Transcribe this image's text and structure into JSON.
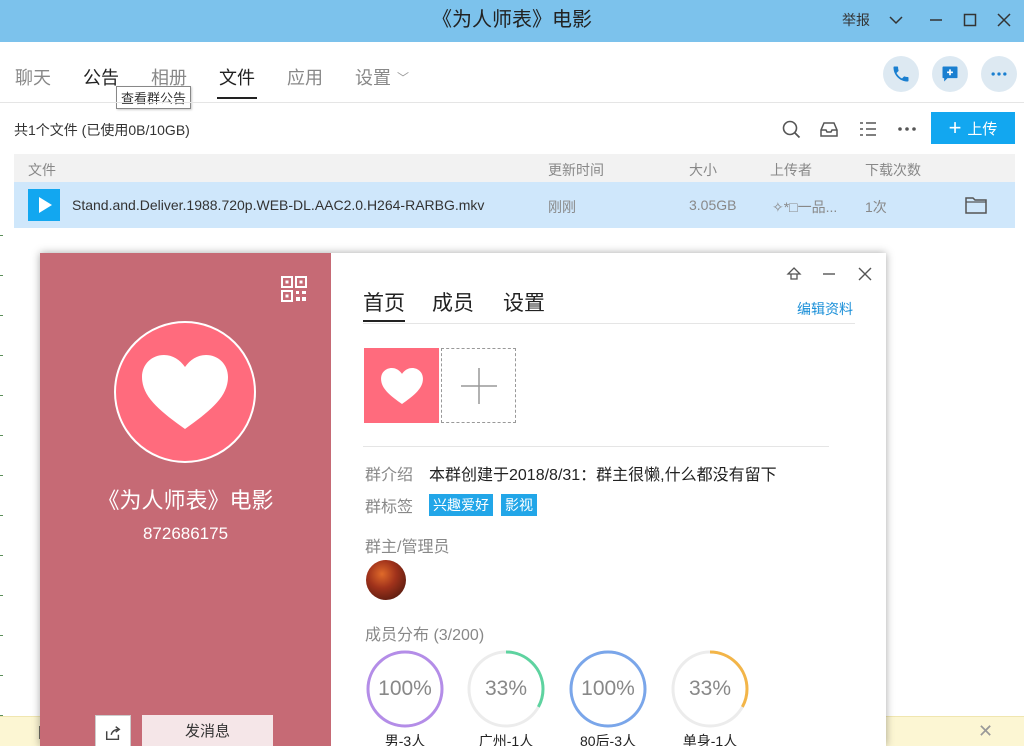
{
  "window": {
    "title": "《为人师表》电影",
    "report_label": "举报"
  },
  "tabs": {
    "items": [
      {
        "label": "聊天"
      },
      {
        "label": "公告"
      },
      {
        "label": "相册"
      },
      {
        "label": "文件"
      },
      {
        "label": "应用"
      },
      {
        "label": "设置"
      }
    ],
    "active": "文件",
    "tooltip": "查看群公告"
  },
  "toolbar": {
    "summary": "共1个文件 (已使用0B/10GB)",
    "upload_label": "上传"
  },
  "table": {
    "headers": {
      "file": "文件",
      "updated": "更新时间",
      "size": "大小",
      "uploader": "上传者",
      "downloads": "下载次数"
    },
    "rows": [
      {
        "name": "Stand.and.Deliver.1988.720p.WEB-DL.AAC2.0.H264-RARBG.mkv",
        "updated": "刚刚",
        "size": "3.05GB",
        "uploader": "✧*□一品...",
        "downloads": "1次"
      }
    ]
  },
  "group_card": {
    "name": "《为人师表》电影",
    "id": "872686175",
    "send_message": "发消息",
    "tabs": {
      "home": "首页",
      "members": "成员",
      "settings": "设置"
    },
    "edit_profile": "编辑资料",
    "intro_label": "群介绍",
    "intro_value": "本群创建于2018/8/31：群主很懒,什么都没有留下",
    "tags_label": "群标签",
    "tags": [
      "兴趣爱好",
      "影视"
    ],
    "admins_label": "群主/管理员",
    "distribution_label": "成员分布 (3/200)",
    "distribution": [
      {
        "pct_label": "100%",
        "pct": 1.0,
        "label": "男-3人",
        "color": "#b48de8"
      },
      {
        "pct_label": "33%",
        "pct": 0.33,
        "label": "广州-1人",
        "color": "#5ed3a0"
      },
      {
        "pct_label": "100%",
        "pct": 1.0,
        "label": "80后-3人",
        "color": "#7aa6ea"
      },
      {
        "pct_label": "33%",
        "pct": 0.33,
        "label": "单身-1人",
        "color": "#f3b548"
      }
    ]
  },
  "colors": {
    "titlebar": "#7cc2ec",
    "accent": "#12a7f0",
    "card_left": "#c66a75",
    "avatar": "#ff6b7d"
  }
}
